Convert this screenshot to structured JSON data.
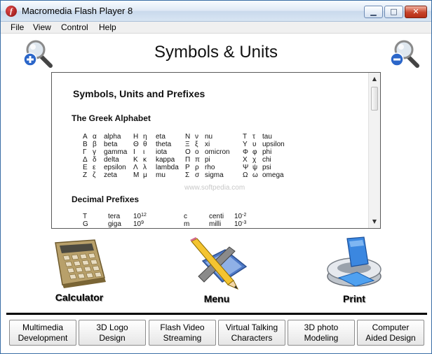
{
  "window": {
    "title": "Macromedia Flash Player 8",
    "app_icon_glyph": "f",
    "controls": {
      "minimize": "▁",
      "maximize": "□",
      "close": "✕"
    }
  },
  "menubar": [
    "File",
    "View",
    "Control",
    "Help"
  ],
  "page": {
    "title": "Symbols & Units"
  },
  "zoom": {
    "in_icon": "zoom-in-magnifier-icon",
    "out_icon": "zoom-out-magnifier-icon"
  },
  "document": {
    "heading": "Symbols, Units and Prefixes",
    "greek_title": "The Greek Alphabet",
    "greek_rows": [
      [
        "Α",
        "α",
        "alpha",
        "Η",
        "η",
        "eta",
        "Ν",
        "ν",
        "nu",
        "Τ",
        "τ",
        "tau"
      ],
      [
        "Β",
        "β",
        "beta",
        "Θ",
        "θ",
        "theta",
        "Ξ",
        "ξ",
        "xi",
        "Υ",
        "υ",
        "upsilon"
      ],
      [
        "Γ",
        "γ",
        "gamma",
        "Ι",
        "ι",
        "iota",
        "Ο",
        "ο",
        "omicron",
        "Φ",
        "φ",
        "phi"
      ],
      [
        "Δ",
        "δ",
        "delta",
        "Κ",
        "κ",
        "kappa",
        "Π",
        "π",
        "pi",
        "Χ",
        "χ",
        "chi"
      ],
      [
        "Ε",
        "ε",
        "epsilon",
        "Λ",
        "λ",
        "lambda",
        "Ρ",
        "ρ",
        "rho",
        "Ψ",
        "ψ",
        "psi"
      ],
      [
        "Ζ",
        "ζ",
        "zeta",
        "Μ",
        "μ",
        "mu",
        "Σ",
        "σ",
        "sigma",
        "Ω",
        "ω",
        "omega"
      ]
    ],
    "prefix_title": "Decimal Prefixes",
    "prefix_rows": [
      {
        "sym1": "T",
        "name1": "tera",
        "base1": "10",
        "exp1": "12",
        "sym2": "c",
        "name2": "centi",
        "base2": "10",
        "exp2": "-2"
      },
      {
        "sym1": "G",
        "name1": "giga",
        "base1": "10",
        "exp1": "9",
        "sym2": "m",
        "name2": "milli",
        "base2": "10",
        "exp2": "-3"
      }
    ],
    "scroll": {
      "up": "▲",
      "down": "▼",
      "position": 0.0
    }
  },
  "watermark": "www.softpedia.com",
  "actions": {
    "calculator": "Calculator",
    "menu": "Menu",
    "print": "Print"
  },
  "bottom_buttons": [
    "Multimedia\nDevelopment",
    "3D Logo\nDesign",
    "Flash Video\nStreaming",
    "Virtual Talking\nCharacters",
    "3D photo\nModeling",
    "Computer\nAided Design"
  ]
}
